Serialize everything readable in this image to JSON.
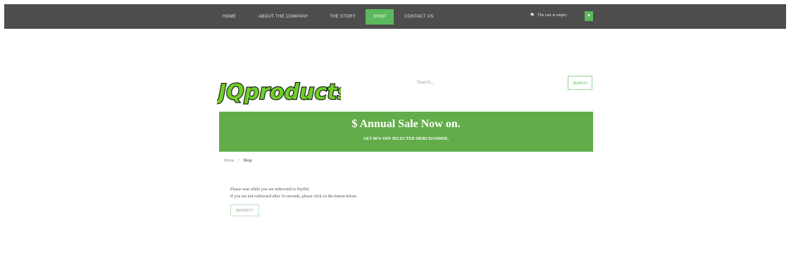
{
  "nav": {
    "items": [
      {
        "label": "HOME"
      },
      {
        "label": "ABOUT THE COMPANY"
      },
      {
        "label": "THE STORY"
      },
      {
        "label": "SHOP",
        "active": true
      },
      {
        "label": "CONTACT US"
      }
    ]
  },
  "cart": {
    "text": "The cart is empty",
    "icon": "cart-icon",
    "button_icon": "chevron-down-icon"
  },
  "logo": {
    "text": "JQproducts"
  },
  "search": {
    "placeholder": "Search...",
    "button_label": "SEARCH"
  },
  "banner": {
    "title": "$ Annual Sale Now on.",
    "subtitle": "GET 60% OFF SELECTED MERCHANDISE."
  },
  "breadcrumb": {
    "home": "Home",
    "separator": "/",
    "current": "Shop"
  },
  "message": {
    "line1": "Please wait while you are redirected to PayPal.",
    "line2": "If you are not redirected after 10 seconds, please click on the button below."
  },
  "redirect_button": {
    "label": "REDIRECT"
  },
  "colors": {
    "topbar": "#4d4d4d",
    "accent": "#5cb85c",
    "banner": "#62ad4a",
    "logo_green": "#6fcf2a"
  }
}
